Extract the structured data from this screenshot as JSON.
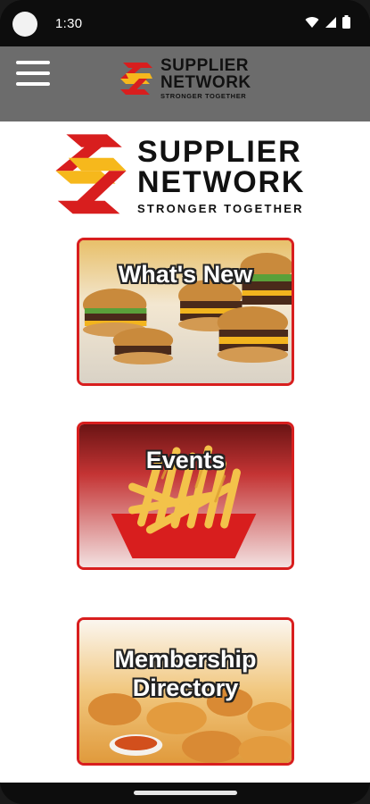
{
  "status_bar": {
    "time": "1:30",
    "icons": [
      "wifi-icon",
      "signal-icon",
      "battery-icon"
    ]
  },
  "app_bar": {
    "menu_icon": "hamburger-menu-icon",
    "logo": {
      "line1": "SUPPLIER",
      "line2": "NETWORK",
      "tagline": "STRONGER TOGETHER"
    }
  },
  "main_logo": {
    "line1": "SUPPLIER",
    "line2": "NETWORK",
    "tagline": "STRONGER TOGETHER"
  },
  "tiles": [
    {
      "label": "What's New",
      "image": "burgers-photo"
    },
    {
      "label": "Events",
      "image": "fries-photo"
    },
    {
      "label_line1": "Membership",
      "label_line2": "Directory",
      "image": "chicken-nuggets-photo"
    }
  ],
  "colors": {
    "brand_red": "#d81e1e",
    "brand_yellow": "#f6b81c",
    "app_bar_bg": "#6c6c6c",
    "status_bar_bg": "#0d0d0d"
  }
}
